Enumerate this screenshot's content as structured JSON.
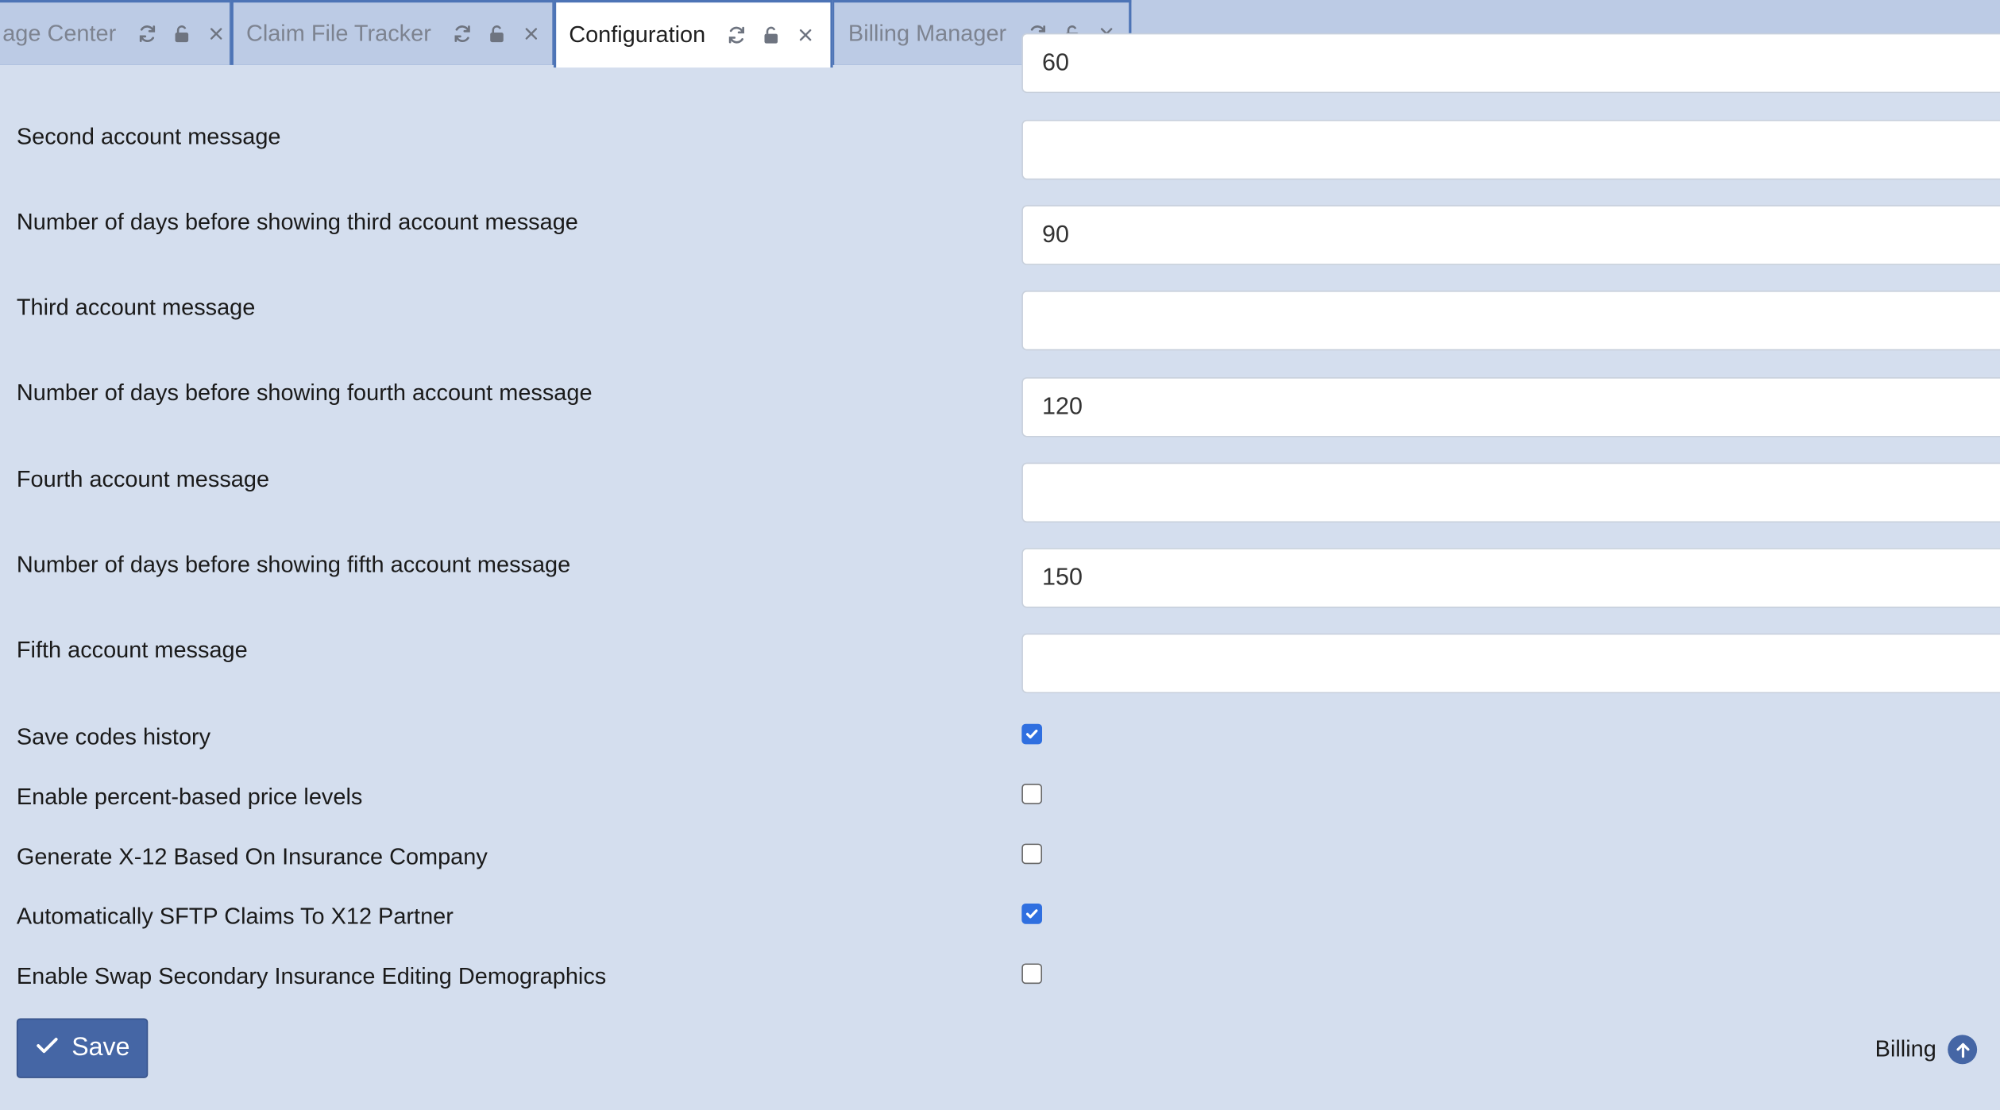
{
  "tabs": [
    {
      "label": "age Center",
      "active": false
    },
    {
      "label": "Claim File Tracker",
      "active": false
    },
    {
      "label": "Configuration",
      "active": true
    },
    {
      "label": "Billing Manager",
      "active": false
    }
  ],
  "form": {
    "partial_top_field_value": "60",
    "second_message_label": "Second account message",
    "second_message_value": "",
    "third_days_label": "Number of days before showing third account message",
    "third_days_value": "90",
    "third_message_label": "Third account message",
    "third_message_value": "",
    "fourth_days_label": "Number of days before showing fourth account message",
    "fourth_days_value": "120",
    "fourth_message_label": "Fourth account message",
    "fourth_message_value": "",
    "fifth_days_label": "Number of days before showing fifth account message",
    "fifth_days_value": "150",
    "fifth_message_label": "Fifth account message",
    "fifth_message_value": ""
  },
  "checkboxes": [
    {
      "label": "Save codes history",
      "checked": true
    },
    {
      "label": "Enable percent-based price levels",
      "checked": false
    },
    {
      "label": "Generate X-12 Based On Insurance Company",
      "checked": false
    },
    {
      "label": "Automatically SFTP Claims To X12 Partner",
      "checked": true
    },
    {
      "label": "Enable Swap Secondary Insurance Editing Demographics",
      "checked": false
    }
  ],
  "footer": {
    "save_label": "Save",
    "billing_label": "Billing"
  },
  "colors": {
    "background": "#d4deee",
    "tabbar": "#bccbe5",
    "accent": "#4566a5",
    "checkbox_checked": "#2f6fe0"
  }
}
